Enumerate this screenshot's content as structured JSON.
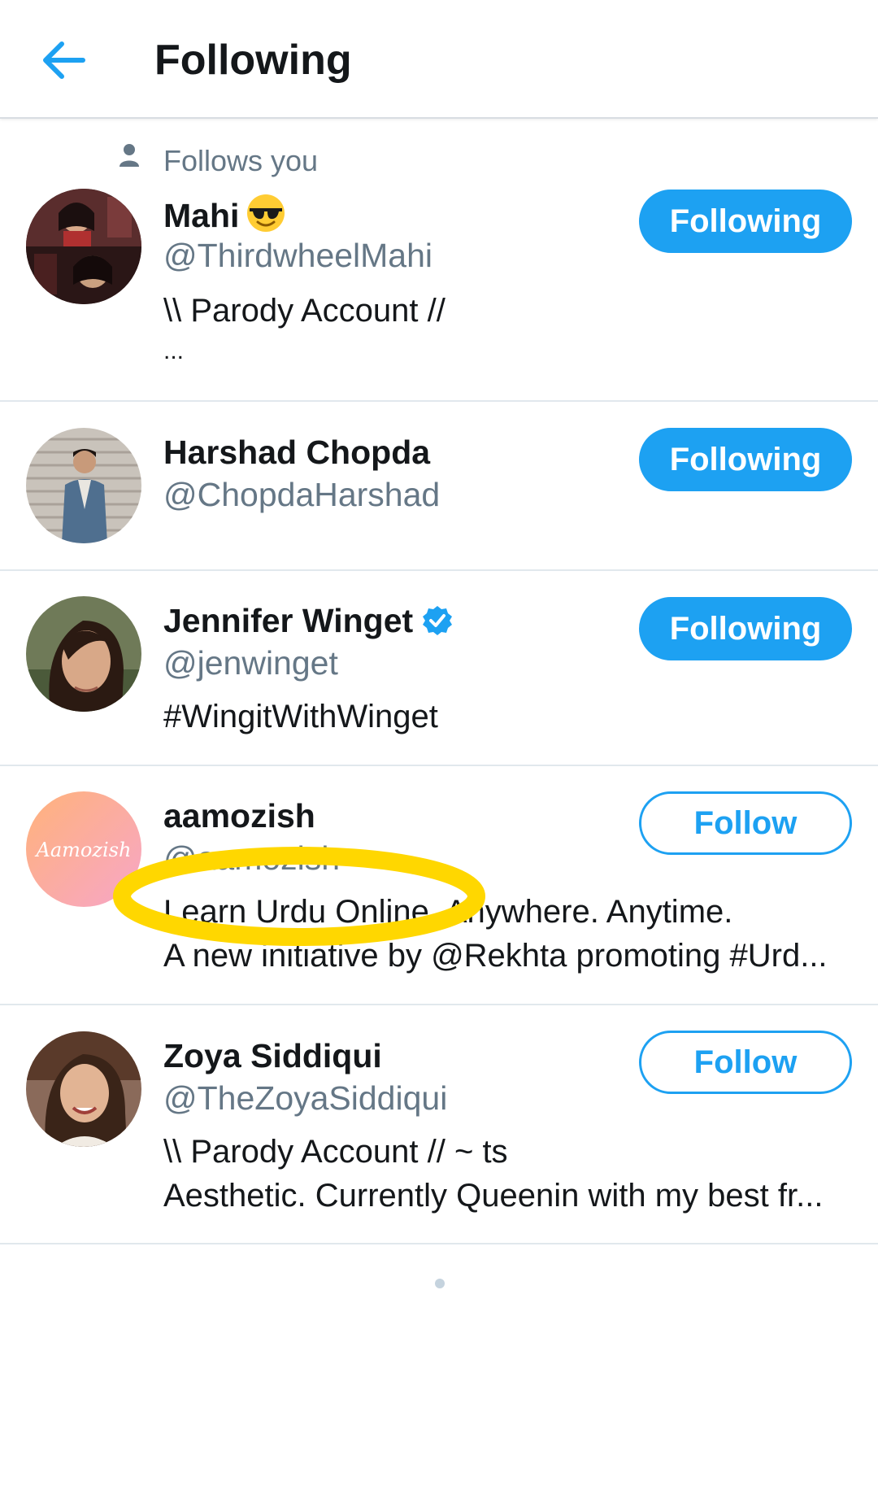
{
  "header": {
    "back_icon": "arrow-left-icon",
    "title": "Following",
    "accent_color": "#1da1f2"
  },
  "users": [
    {
      "follows_you": "Follows you",
      "name": "Mahi",
      "name_emoji": "sunglasses-emoji",
      "handle": "@ThirdwheelMahi",
      "bio": [
        "\\\\ Parody Account //",
        "..."
      ],
      "button": "Following"
    },
    {
      "name": "Harshad Chopda",
      "handle": "@ChopdaHarshad",
      "bio": [],
      "button": "Following"
    },
    {
      "name": "Jennifer Winget",
      "verified": "verified-badge-icon",
      "handle": "@jenwinget",
      "bio": [
        "#WingitWithWinget"
      ],
      "button": "Following"
    },
    {
      "name": "aamozish",
      "avatar_text": "Aamozish",
      "handle": "@aamozish",
      "bio": [
        "Learn Urdu Online. Anywhere. Anytime.",
        "A new initiative by @Rekhta promoting #Urd..."
      ],
      "button": "Follow"
    },
    {
      "name": "Zoya Siddiqui",
      "handle": "@TheZoyaSiddiqui",
      "bio": [
        "\\\\ Parody Account // ~ ts",
        "Aesthetic. Currently Queenin with my best fr..."
      ],
      "button": "Follow"
    }
  ],
  "annotation": {
    "highlight_color": "#ffd700"
  }
}
